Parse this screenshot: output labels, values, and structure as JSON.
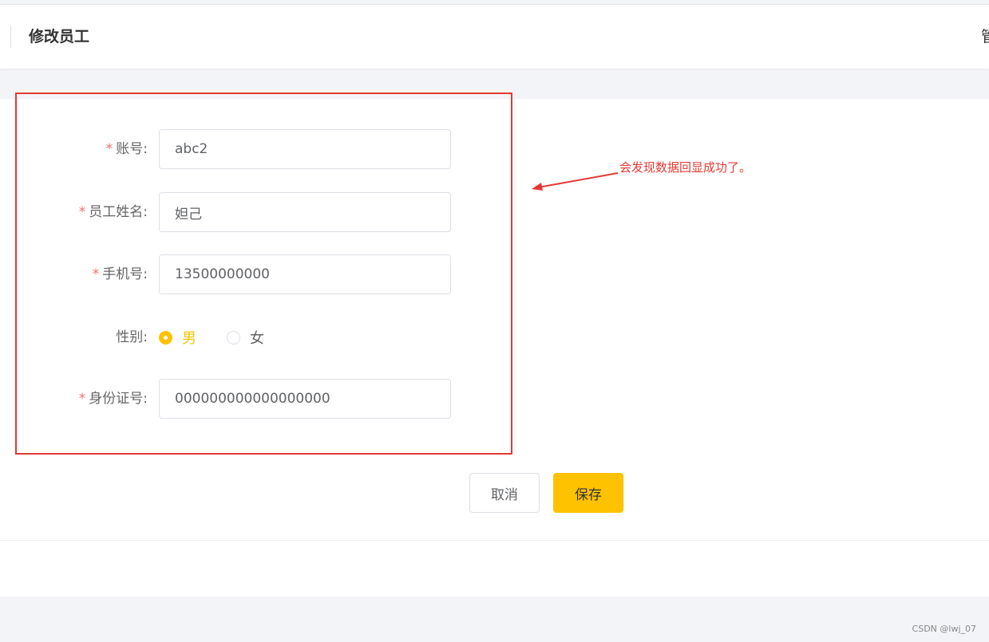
{
  "header": {
    "title": "修改员工",
    "right_text": "管"
  },
  "form": {
    "account": {
      "label": "账号:",
      "value": "abc2",
      "required": true
    },
    "name": {
      "label": "员工姓名:",
      "value": "妲己",
      "required": true
    },
    "phone": {
      "label": "手机号:",
      "value": "13500000000",
      "required": true
    },
    "gender": {
      "label": "性别:",
      "options": [
        {
          "label": "男",
          "checked": true
        },
        {
          "label": "女",
          "checked": false
        }
      ]
    },
    "id_number": {
      "label": "身份证号:",
      "value": "000000000000000000",
      "required": true
    },
    "required_mark": "*"
  },
  "actions": {
    "cancel_label": "取消",
    "save_label": "保存"
  },
  "annotation": {
    "text": "会发现数据回显成功了。",
    "color": "#e53935"
  },
  "theme": {
    "accent": "#ffc200",
    "required": "#f56c6c"
  },
  "watermark": "CSDN @lwj_07"
}
